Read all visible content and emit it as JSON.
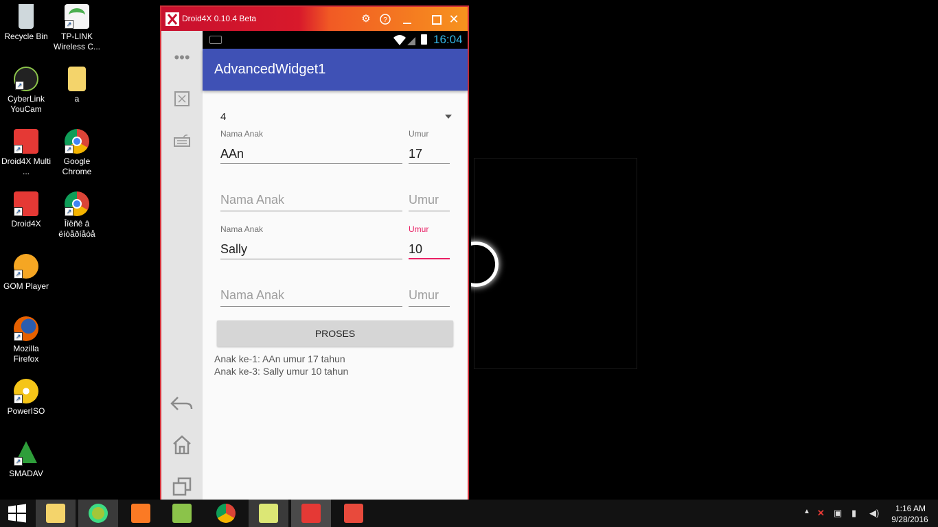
{
  "desktop": {
    "icons": [
      {
        "label": "Recycle Bin",
        "icon": "recycle-bin-icon",
        "color": "#cfd8dc"
      },
      {
        "label": "TP-LINK Wireless C...",
        "icon": "wifi-icon",
        "color": "#4caf50"
      },
      {
        "label": "CyberLink YouCam",
        "icon": "webcam-icon",
        "color": "#222222"
      },
      {
        "label": "a",
        "icon": "folder-icon",
        "color": "#f4d46b"
      },
      {
        "label": "Droid4X Multi ...",
        "icon": "droid4x-icon",
        "color": "#e53935"
      },
      {
        "label": "Google Chrome",
        "icon": "chrome-icon",
        "color": "#4285f4"
      },
      {
        "label": "Droid4X",
        "icon": "droid4x-icon",
        "color": "#e53935"
      },
      {
        "label": "Îîëñê â ëíòåðíåòå",
        "icon": "chrome-icon",
        "color": "#4285f4"
      },
      {
        "label": "GOM Player",
        "icon": "gom-player-icon",
        "color": "#f5a623"
      },
      {
        "label": "Mozilla Firefox",
        "icon": "firefox-icon",
        "color": "#e66000"
      },
      {
        "label": "PowerISO",
        "icon": "poweriso-icon",
        "color": "#f5c518"
      },
      {
        "label": "SMADAV",
        "icon": "smadav-icon",
        "color": "#2e9e3a"
      }
    ]
  },
  "emulator": {
    "title": "Droid4X 0.10.4 Beta",
    "title_buttons": [
      "gear-icon",
      "help-icon",
      "minimize-icon",
      "maximize-icon",
      "close-icon"
    ],
    "sidebar": [
      "more-icon",
      "fullscreen-icon",
      "keyboard-icon",
      "back-icon",
      "home-icon",
      "recents-icon"
    ]
  },
  "android": {
    "status_time": "16:04",
    "app_title": "AdvancedWidget1",
    "spinner_value": "4",
    "rows": [
      {
        "name_label": "Nama Anak",
        "name_value": "AAn",
        "age_label": "Umur",
        "age_value": "17"
      },
      {
        "name_placeholder": "Nama Anak",
        "age_placeholder": "Umur"
      },
      {
        "name_label": "Nama Anak",
        "name_value": "Sally",
        "age_label": "Umur",
        "age_value": "10"
      },
      {
        "name_placeholder": "Nama Anak",
        "age_placeholder": "Umur"
      }
    ],
    "button_label": "PROSES",
    "results": [
      "Anak ke-1: AAn umur 17 tahun",
      "Anak ke-3: Sally umur 10 tahun"
    ],
    "colors": {
      "appbar": "#3f51b5",
      "accent": "#e91e63"
    }
  },
  "taskbar": {
    "apps": [
      "file-explorer-icon",
      "android-studio-icon",
      "xampp-icon",
      "notepad-plus-icon",
      "chrome-icon",
      "folder-icon",
      "droid4x-icon",
      "app-icon"
    ],
    "clock_time": "1:16 AM",
    "clock_date": "9/28/2016"
  }
}
